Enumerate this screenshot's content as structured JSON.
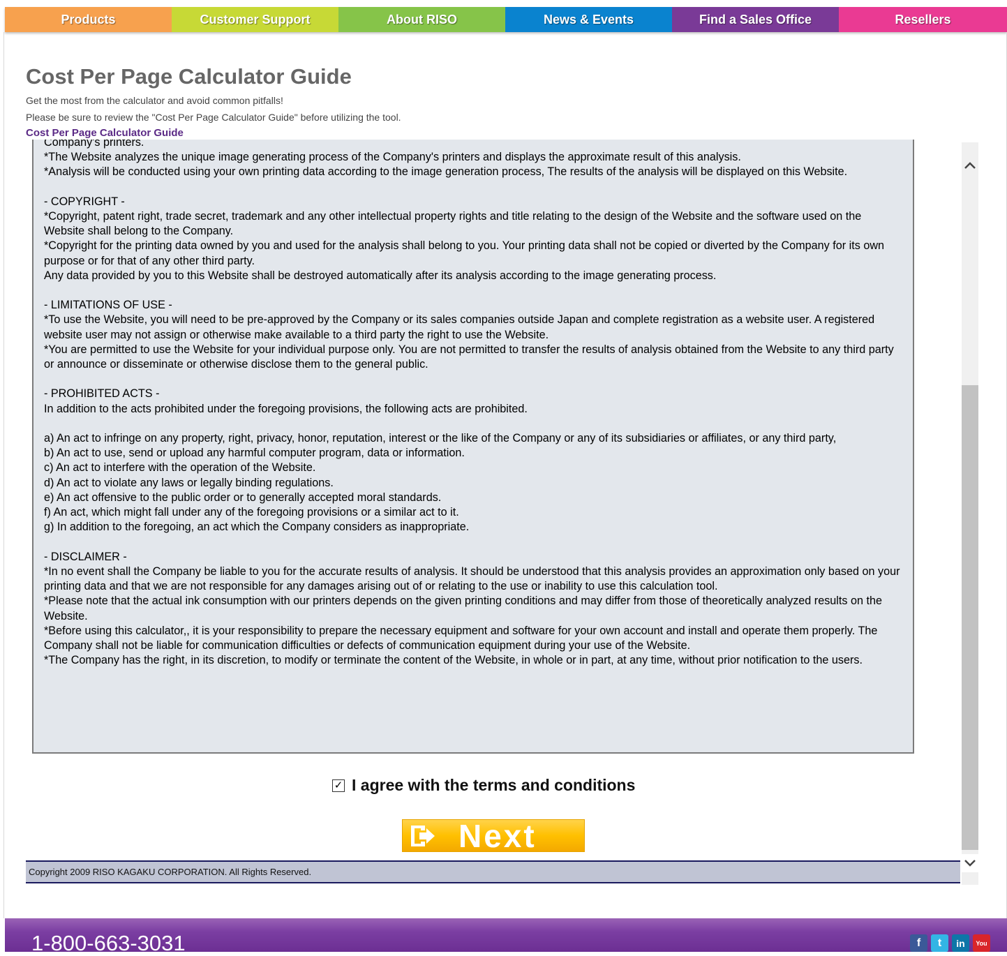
{
  "nav": {
    "items": [
      {
        "label": "Products",
        "color": "#f7a14e"
      },
      {
        "label": "Customer Support",
        "color": "#c7d936"
      },
      {
        "label": "About RISO",
        "color": "#86c449"
      },
      {
        "label": "News & Events",
        "color": "#0a83cf"
      },
      {
        "label": "Find a Sales Office",
        "color": "#7a3a97"
      },
      {
        "label": "Resellers",
        "color": "#ea3a93"
      }
    ]
  },
  "header": {
    "title": "Cost Per Page Calculator Guide",
    "subtitle1": "Get the most from the calculator and avoid common pitfalls!",
    "subtitle2": "Please be sure to review the \"Cost Per Page Calculator Guide\" before utilizing the tool.",
    "guide_link": "Cost Per Page Calculator Guide"
  },
  "terms": {
    "text": "Company's printers.\n*The Website analyzes the unique image generating process of the Company's printers and displays the approximate result of this analysis.\n*Analysis will be conducted using your own printing data according to the image generation process, The results of the analysis will be displayed on this Website.\n\n- COPYRIGHT -\n*Copyright, patent right, trade secret, trademark and any other intellectual property rights and title relating to the design of the Website and the software used on the Website shall belong to the Company.\n*Copyright for the printing data owned by you and used for the analysis shall belong to you. Your printing data shall not be copied or diverted by the Company for its own purpose or for that of any other third party.\nAny data provided by you to this Website shall be destroyed automatically after its analysis according to the image generating process.\n\n- LIMITATIONS OF USE -\n*To use the Website, you will need to be pre-approved by the Company or its sales companies outside Japan and complete registration as a website user. A registered website user may not assign or otherwise make available to a third party the right to use the Website.\n*You are permitted to use the Website for your individual purpose only. You are not permitted to transfer the results of analysis obtained from the Website to any third party or announce or disseminate or otherwise disclose them to the general public.\n\n- PROHIBITED ACTS -\nIn addition to the acts prohibited under the foregoing provisions, the following acts are prohibited.\n\na) An act to infringe on any property, right, privacy, honor, reputation, interest or the like of the Company or any of its subsidiaries or affiliates, or any third party,\nb) An act to use, send or upload any harmful computer program, data or information.\nc) An act to interfere with the operation of the Website.\nd) An act to violate any laws or legally binding regulations.\ne) An act offensive to the public order or to generally accepted moral standards.\nf) An act, which might fall under any of the foregoing provisions or a similar act to it.\ng) In addition to the foregoing, an act which the Company considers as inappropriate.\n\n- DISCLAIMER -\n*In no event shall the Company be liable to you for the accurate results of analysis. It should be understood that this analysis provides an approximation only based on your printing data and that we are not responsible for any damages arising out of or relating to the use or inability to use this calculation tool.\n*Please note that the actual ink consumption with our printers depends on the given printing conditions and may differ from those of theoretically analyzed results on the Website.\n*Before using this calculator,, it is your responsibility to prepare the necessary equipment and software for your own account and install and operate them properly. The Company shall not be liable for communication difficulties or defects of communication equipment during your use of the Website.\n*The Company has the right, in its discretion, to modify or terminate the content of the Website, in whole or in part, at any time, without prior notification to the users."
  },
  "agreement": {
    "label": "I agree with the terms and conditions",
    "checked": true,
    "check_glyph": "✓"
  },
  "next_button": {
    "label": "Next",
    "icon": "arrow-right-box-icon"
  },
  "footer": {
    "copyright": "Copyright 2009 RISO KAGAKU CORPORATION. All Rights Reserved.",
    "phone": "1-800-663-3031",
    "social": [
      {
        "name": "facebook-icon",
        "glyph": "f",
        "color": "#3b5998"
      },
      {
        "name": "twitter-icon",
        "glyph": "t",
        "color": "#33b5e5"
      },
      {
        "name": "linkedin-icon",
        "glyph": "in",
        "color": "#0e76a8"
      },
      {
        "name": "youtube-icon",
        "glyph": "You",
        "color": "#d9252a"
      }
    ]
  }
}
